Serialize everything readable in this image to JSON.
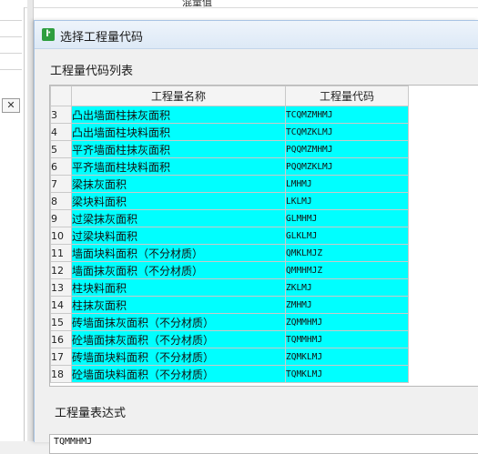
{
  "background": {
    "top_text": "混量值"
  },
  "dialog": {
    "title": "选择工程量代码",
    "list_label": "工程量代码列表",
    "expr_label": "工程量表达式",
    "expr_value": "TQMMHMJ"
  },
  "table": {
    "headers": {
      "name": "工程量名称",
      "code": "工程量代码"
    },
    "rows": [
      {
        "num": "3",
        "name": "凸出墙面柱抹灰面积",
        "code": "TCQMZMHMJ"
      },
      {
        "num": "4",
        "name": "凸出墙面柱块料面积",
        "code": "TCQMZKLMJ"
      },
      {
        "num": "5",
        "name": "平齐墙面柱抹灰面积",
        "code": "PQQMZMHMJ"
      },
      {
        "num": "6",
        "name": "平齐墙面柱块料面积",
        "code": "PQQMZKLMJ"
      },
      {
        "num": "7",
        "name": "梁抹灰面积",
        "code": "LMHMJ"
      },
      {
        "num": "8",
        "name": "梁块料面积",
        "code": "LKLMJ"
      },
      {
        "num": "9",
        "name": "过梁抹灰面积",
        "code": "GLMHMJ"
      },
      {
        "num": "10",
        "name": "过梁块料面积",
        "code": "GLKLMJ"
      },
      {
        "num": "11",
        "name": "墙面块料面积（不分材质）",
        "code": "QMKLMJZ"
      },
      {
        "num": "12",
        "name": "墙面抹灰面积（不分材质）",
        "code": "QMMHMJZ"
      },
      {
        "num": "13",
        "name": "柱块料面积",
        "code": "ZKLMJ"
      },
      {
        "num": "14",
        "name": "柱抹灰面积",
        "code": "ZMHMJ"
      },
      {
        "num": "15",
        "name": "砖墙面抹灰面积（不分材质）",
        "code": "ZQMMHMJ"
      },
      {
        "num": "16",
        "name": "砼墙面抹灰面积（不分材质）",
        "code": "TQMMHMJ"
      },
      {
        "num": "17",
        "name": "砖墙面块料面积（不分材质）",
        "code": "ZQMKLMJ"
      },
      {
        "num": "18",
        "name": "砼墙面块料面积（不分材质）",
        "code": "TQMKLMJ"
      }
    ]
  },
  "colors": {
    "selected_cell": "#00ffff",
    "header_highlight": "#f7c76d"
  }
}
